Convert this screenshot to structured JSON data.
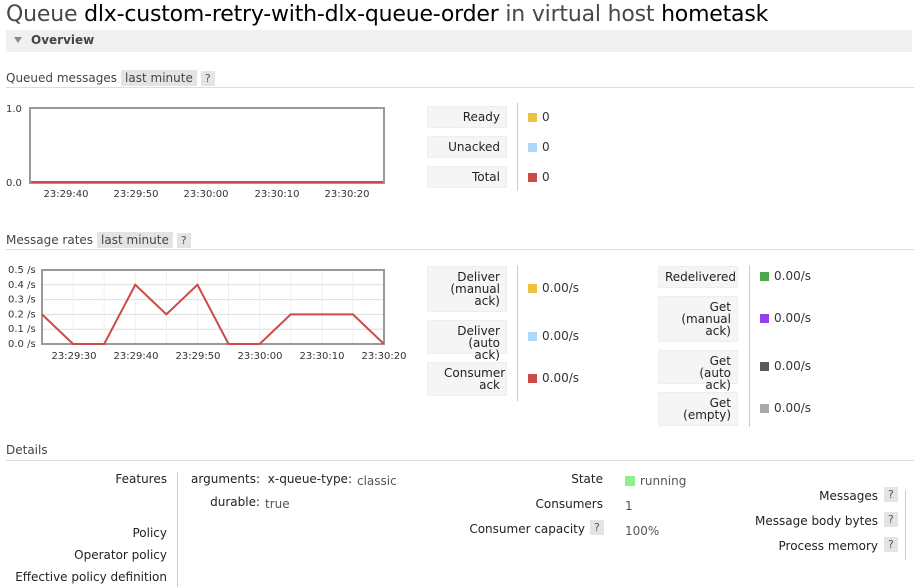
{
  "header": {
    "prefix": "Queue",
    "queue_name": "dlx-custom-retry-with-dlx-queue-order",
    "mid": "in virtual host",
    "vhost": "hometask"
  },
  "overview": {
    "label": "Overview"
  },
  "queued": {
    "heading": "Queued messages",
    "range": "last minute",
    "help": "?",
    "legend": [
      {
        "label": "Ready",
        "value": "0",
        "color": "#edc240"
      },
      {
        "label": "Unacked",
        "value": "0",
        "color": "#afd8f8"
      },
      {
        "label": "Total",
        "value": "0",
        "color": "#cb4b4b"
      }
    ]
  },
  "rates": {
    "heading": "Message rates",
    "range": "last minute",
    "help": "?",
    "left": [
      {
        "label": "Deliver (manual ack)",
        "value": "0.00/s",
        "color": "#edc240"
      },
      {
        "label": "Deliver (auto ack)",
        "value": "0.00/s",
        "color": "#afd8f8"
      },
      {
        "label": "Consumer ack",
        "value": "0.00/s",
        "color": "#cb4b4b"
      }
    ],
    "right": [
      {
        "label": "Redelivered",
        "value": "0.00/s",
        "color": "#4da74d"
      },
      {
        "label": "Get (manual ack)",
        "value": "0.00/s",
        "color": "#9440ed"
      },
      {
        "label": "Get (auto ack)",
        "value": "0.00/s",
        "color": "#5a5a5a"
      },
      {
        "label": "Get (empty)",
        "value": "0.00/s",
        "color": "#a9a9a9"
      }
    ]
  },
  "chart_data": [
    {
      "type": "line",
      "x": [
        "23:29:40",
        "23:29:50",
        "23:30:00",
        "23:30:10",
        "23:30:20"
      ],
      "series": [
        {
          "name": "Total",
          "values": [
            0,
            0,
            0,
            0,
            0
          ]
        }
      ],
      "ylim": [
        0,
        1
      ],
      "yticks": [
        "1.0",
        "0.0"
      ],
      "grid": false
    },
    {
      "type": "line",
      "x": [
        "23:29:25",
        "23:29:30",
        "23:29:35",
        "23:29:40",
        "23:29:45",
        "23:29:50",
        "23:29:55",
        "23:30:00",
        "23:30:05",
        "23:30:10",
        "23:30:15",
        "23:30:20"
      ],
      "xticks": [
        "23:29:30",
        "23:29:40",
        "23:29:50",
        "23:30:00",
        "23:30:10",
        "23:30:20"
      ],
      "series": [
        {
          "name": "Consumer ack",
          "values": [
            0.2,
            0,
            0,
            0.4,
            0.2,
            0.4,
            0,
            0,
            0.2,
            0.2,
            0.2,
            0
          ]
        }
      ],
      "ylim": [
        0,
        0.5
      ],
      "yticks": [
        "0.5 /s",
        "0.4 /s",
        "0.3 /s",
        "0.2 /s",
        "0.1 /s",
        "0.0 /s"
      ],
      "grid": true
    }
  ],
  "details": {
    "heading": "Details",
    "features_label": "Features",
    "features": [
      {
        "key": "arguments:",
        "subkey": "x-queue-type:",
        "value": "classic"
      },
      {
        "key": "durable:",
        "subkey": "",
        "value": "true"
      }
    ],
    "policy_label": "Policy",
    "operator_policy_label": "Operator policy",
    "effective_policy_label": "Effective policy definition",
    "state_label": "State",
    "state_value": "running",
    "state_color": "#8ef08e",
    "consumers_label": "Consumers",
    "consumers_value": "1",
    "capacity_label": "Consumer capacity",
    "capacity_help": "?",
    "capacity_value": "100%",
    "right": [
      {
        "label": "Messages",
        "help": "?"
      },
      {
        "label": "Message body bytes",
        "help": "?"
      },
      {
        "label": "Process memory",
        "help": "?"
      }
    ]
  }
}
